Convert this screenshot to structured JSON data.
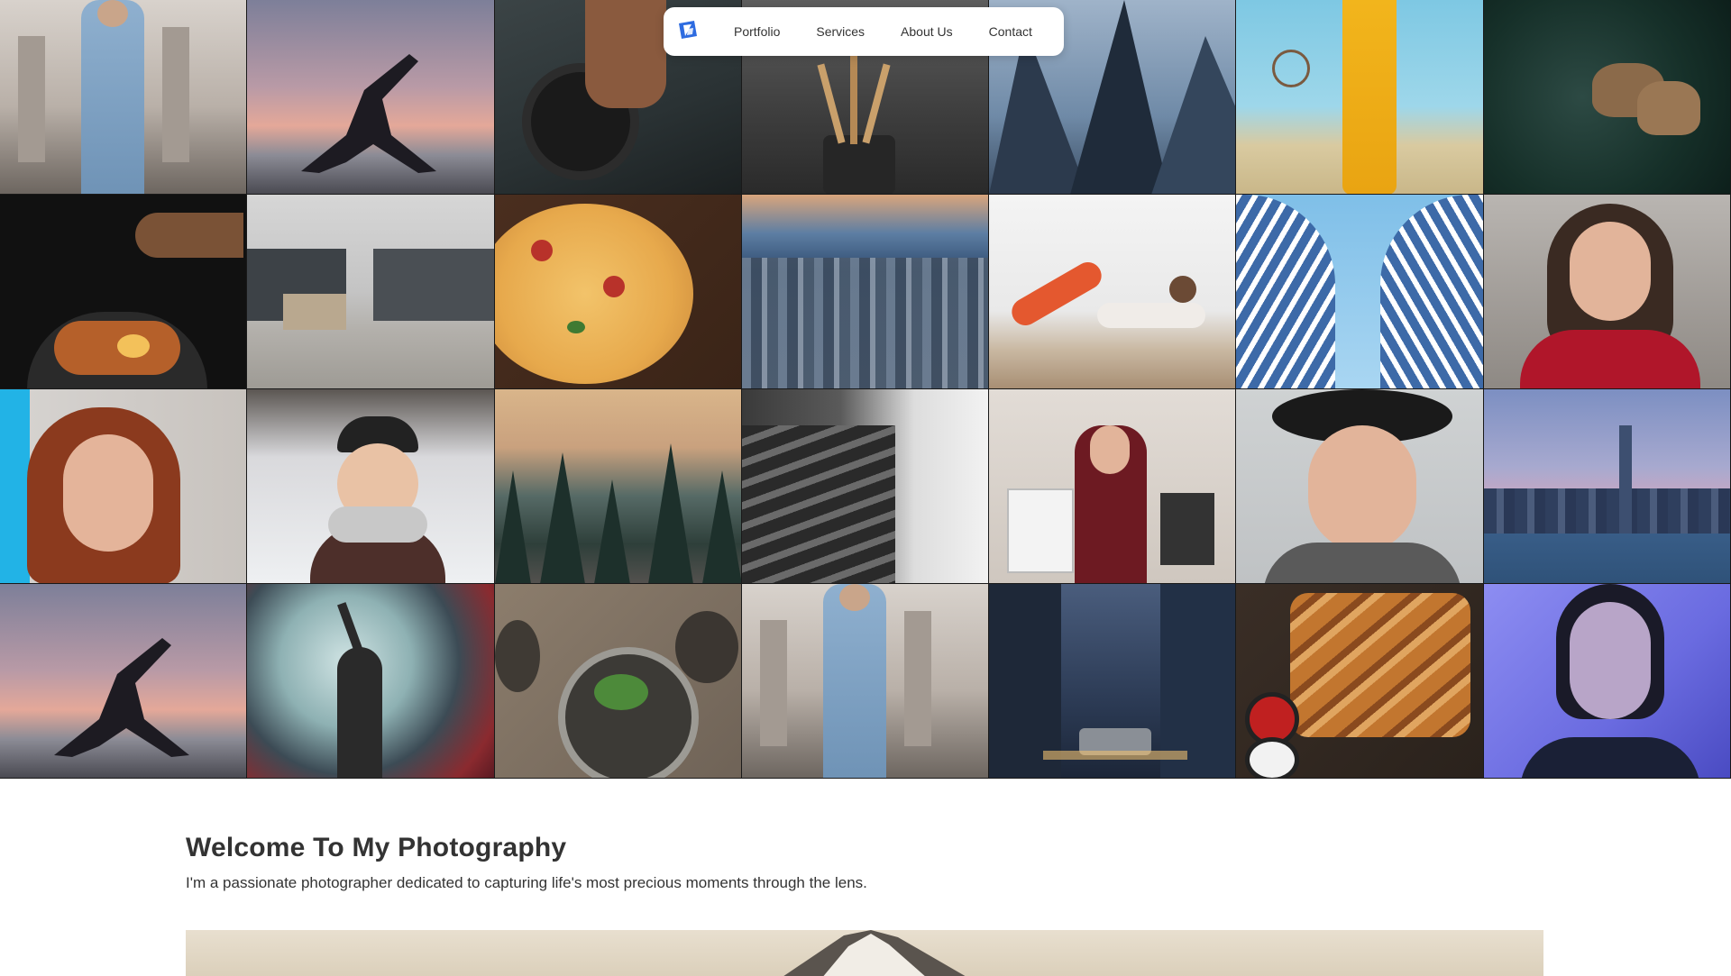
{
  "nav": {
    "logo_icon": "logo-icon",
    "links": [
      {
        "label": "Portfolio"
      },
      {
        "label": "Services"
      },
      {
        "label": "About Us"
      },
      {
        "label": "Contact"
      }
    ],
    "logo_color": "#2d6be0"
  },
  "gallery": {
    "tiles": [
      {
        "subject": "woman-blue-coat-cathedral"
      },
      {
        "subject": "yoga-silhouette-sunset"
      },
      {
        "subject": "weightlifting-barbell"
      },
      {
        "subject": "makeup-brushes"
      },
      {
        "subject": "skyscrapers-looking-up"
      },
      {
        "subject": "woman-yellow-outfit-basketball-hoop"
      },
      {
        "subject": "lions-in-grass"
      },
      {
        "subject": "noodle-bowl-chopsticks"
      },
      {
        "subject": "empty-office-corridor"
      },
      {
        "subject": "pizza-on-board"
      },
      {
        "subject": "city-aerial-skyline"
      },
      {
        "subject": "woman-doing-crunches"
      },
      {
        "subject": "curved-blue-building"
      },
      {
        "subject": "smiling-woman-red-top"
      },
      {
        "subject": "red-haired-woman-portrait"
      },
      {
        "subject": "woman-beanie-snow"
      },
      {
        "subject": "pine-forest-mountains"
      },
      {
        "subject": "gym-dumbbell-rack"
      },
      {
        "subject": "woman-shopping-bags"
      },
      {
        "subject": "curly-haired-man-hat"
      },
      {
        "subject": "city-skyline-waterfront"
      },
      {
        "subject": "yoga-silhouette-sunset"
      },
      {
        "subject": "dancer-colored-smoke"
      },
      {
        "subject": "food-plates-table"
      },
      {
        "subject": "woman-blue-coat-cathedral"
      },
      {
        "subject": "city-street-traffic"
      },
      {
        "subject": "grilled-skewers-platter"
      },
      {
        "subject": "woman-portrait-blue-light"
      }
    ]
  },
  "welcome": {
    "title": "Welcome To My Photography",
    "text": "I'm a passionate photographer dedicated to capturing life's most precious moments through the lens."
  },
  "banner": {
    "subject": "mountain-peak-sunrise"
  }
}
